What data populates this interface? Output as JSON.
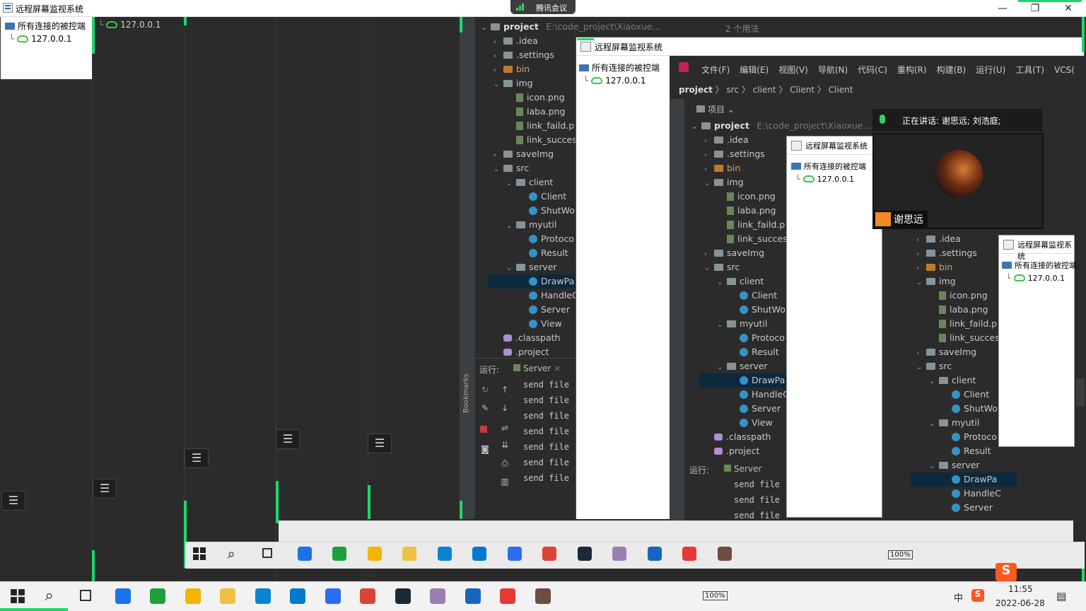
{
  "window": {
    "title": "远程屏幕监视系统",
    "minimize": "—",
    "maximize": "❐",
    "close": "✕"
  },
  "meeting": {
    "app_name": "腾讯会议",
    "speaking_label": "正在讲话: 谢思远; 刘浩庭;",
    "speaker_name": "谢思远",
    "accent": "#1ed76c"
  },
  "tree": {
    "root_label": "所有连接的被控端",
    "client_ip": "127.0.0.1"
  },
  "menu_glyph": "☰",
  "ide": {
    "project_root": "project",
    "project_path": "E:\\code_project\\Xiaoxue...",
    "items": [
      {
        "label": ".idea",
        "kind": "folder"
      },
      {
        "label": ".settings",
        "kind": "folder"
      },
      {
        "label": "bin",
        "kind": "folder-orange"
      },
      {
        "label": "img",
        "kind": "folder"
      },
      {
        "label": "icon.png",
        "kind": "image"
      },
      {
        "label": "laba.png",
        "kind": "image"
      },
      {
        "label": "link_faild.p",
        "kind": "image"
      },
      {
        "label": "link_succes",
        "kind": "image"
      },
      {
        "label": "saveImg",
        "kind": "folder"
      },
      {
        "label": "src",
        "kind": "folder"
      },
      {
        "label": "client",
        "kind": "package"
      },
      {
        "label": "Client",
        "kind": "class"
      },
      {
        "label": "ShutWo",
        "kind": "class"
      },
      {
        "label": "myutil",
        "kind": "package"
      },
      {
        "label": "Protoco",
        "kind": "class"
      },
      {
        "label": "Result",
        "kind": "class"
      },
      {
        "label": "server",
        "kind": "package"
      },
      {
        "label": "DrawPa",
        "kind": "class"
      },
      {
        "label": "HandleC",
        "kind": "class"
      },
      {
        "label": "Server",
        "kind": "class"
      },
      {
        "label": "View",
        "kind": "class"
      },
      {
        "label": ".classpath",
        "kind": "config"
      },
      {
        "label": ".project",
        "kind": "config"
      }
    ],
    "run_label": "运行:",
    "run_config": "Server",
    "console_line": "send file",
    "bookmarks": "Bookmarks",
    "menu": [
      "文件(F)",
      "编辑(E)",
      "视图(V)",
      "导航(N)",
      "代码(C)",
      "重构(R)",
      "构建(B)",
      "运行(U)",
      "工具(T)",
      "VCS("
    ],
    "breadcrumb": [
      "project",
      "src",
      "client",
      "Client",
      "Client"
    ],
    "project_panel": "项目",
    "usages": "2 个用法"
  },
  "taskbar": {
    "battery": "100%",
    "time": "11:55",
    "date": "2022-06-28",
    "ime_lang": "中",
    "ime_logo": "S"
  }
}
